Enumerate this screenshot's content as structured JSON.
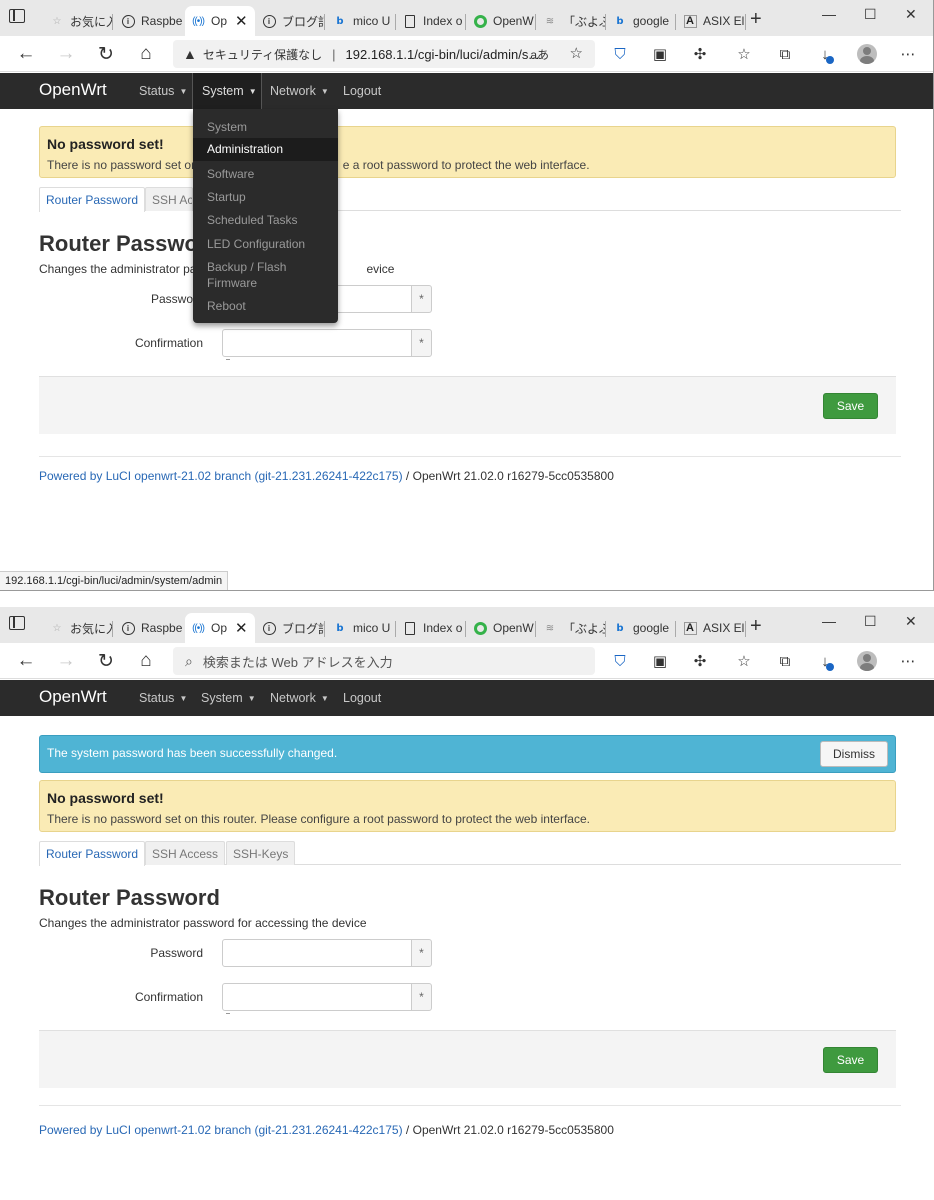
{
  "browser": {
    "tabs": [
      {
        "label": "お気に入",
        "icon": "star-icon"
      },
      {
        "label": "Raspbe",
        "icon": "info-icon"
      },
      {
        "label": "Op",
        "icon": "radio-icon",
        "active": true
      },
      {
        "label": "ブログ記",
        "icon": "info-icon"
      },
      {
        "label": "mico U",
        "icon": "bing-icon"
      },
      {
        "label": "Index o",
        "icon": "document-icon"
      },
      {
        "label": "OpenW",
        "icon": "green-circle-icon"
      },
      {
        "label": "「ぶよぶ",
        "icon": "wifi-icon"
      },
      {
        "label": "google",
        "icon": "bing-icon"
      },
      {
        "label": "ASIX El",
        "icon": "asix-icon"
      }
    ],
    "address_security": "セキュリティ保護なし",
    "address_url": "192.168.1.1/cgi-bin/luci/admin/s...",
    "address_read_aloud": "aあ",
    "address_placeholder": "検索または Web アドレスを入力",
    "status_url": "192.168.1.1/cgi-bin/luci/admin/system/admin"
  },
  "openwrt": {
    "brand": "OpenWrt",
    "menu": [
      "Status",
      "System",
      "Network",
      "Logout"
    ],
    "system_dropdown": [
      "System",
      "Administration",
      "Software",
      "Startup",
      "Scheduled Tasks",
      "LED Configuration",
      "Backup / Flash Firmware",
      "Reboot"
    ],
    "success_message": "The system password has been successfully changed.",
    "dismiss_label": "Dismiss",
    "warning_title": "No password set!",
    "warning_text": "There is no password set on this router. Please configure a root password to protect the web interface.",
    "warning_text_visible_left": "There is no password set on",
    "warning_text_visible_right": "e a root password to protect the web interface.",
    "content_tabs": [
      "Router Password",
      "SSH Access",
      "SSH-Keys"
    ],
    "content_tab_partial": "SSH Acc",
    "page_title": "Router Password",
    "page_title_partial": "Router Passwo",
    "page_desc": "Changes the administrator password for accessing the device",
    "page_desc_partial_left": "Changes the administrator pa",
    "page_desc_partial_right": "evice",
    "label_password": "Password",
    "label_password_partial": "Passwo",
    "label_confirmation": "Confirmation",
    "required_marker": "*",
    "save_label": "Save",
    "footer_link": "Powered by LuCI openwrt-21.02 branch (git-21.231.26241-422c175)",
    "footer_sep": "/",
    "footer_version": "OpenWrt 21.02.0 r16279-5cc0535800"
  }
}
